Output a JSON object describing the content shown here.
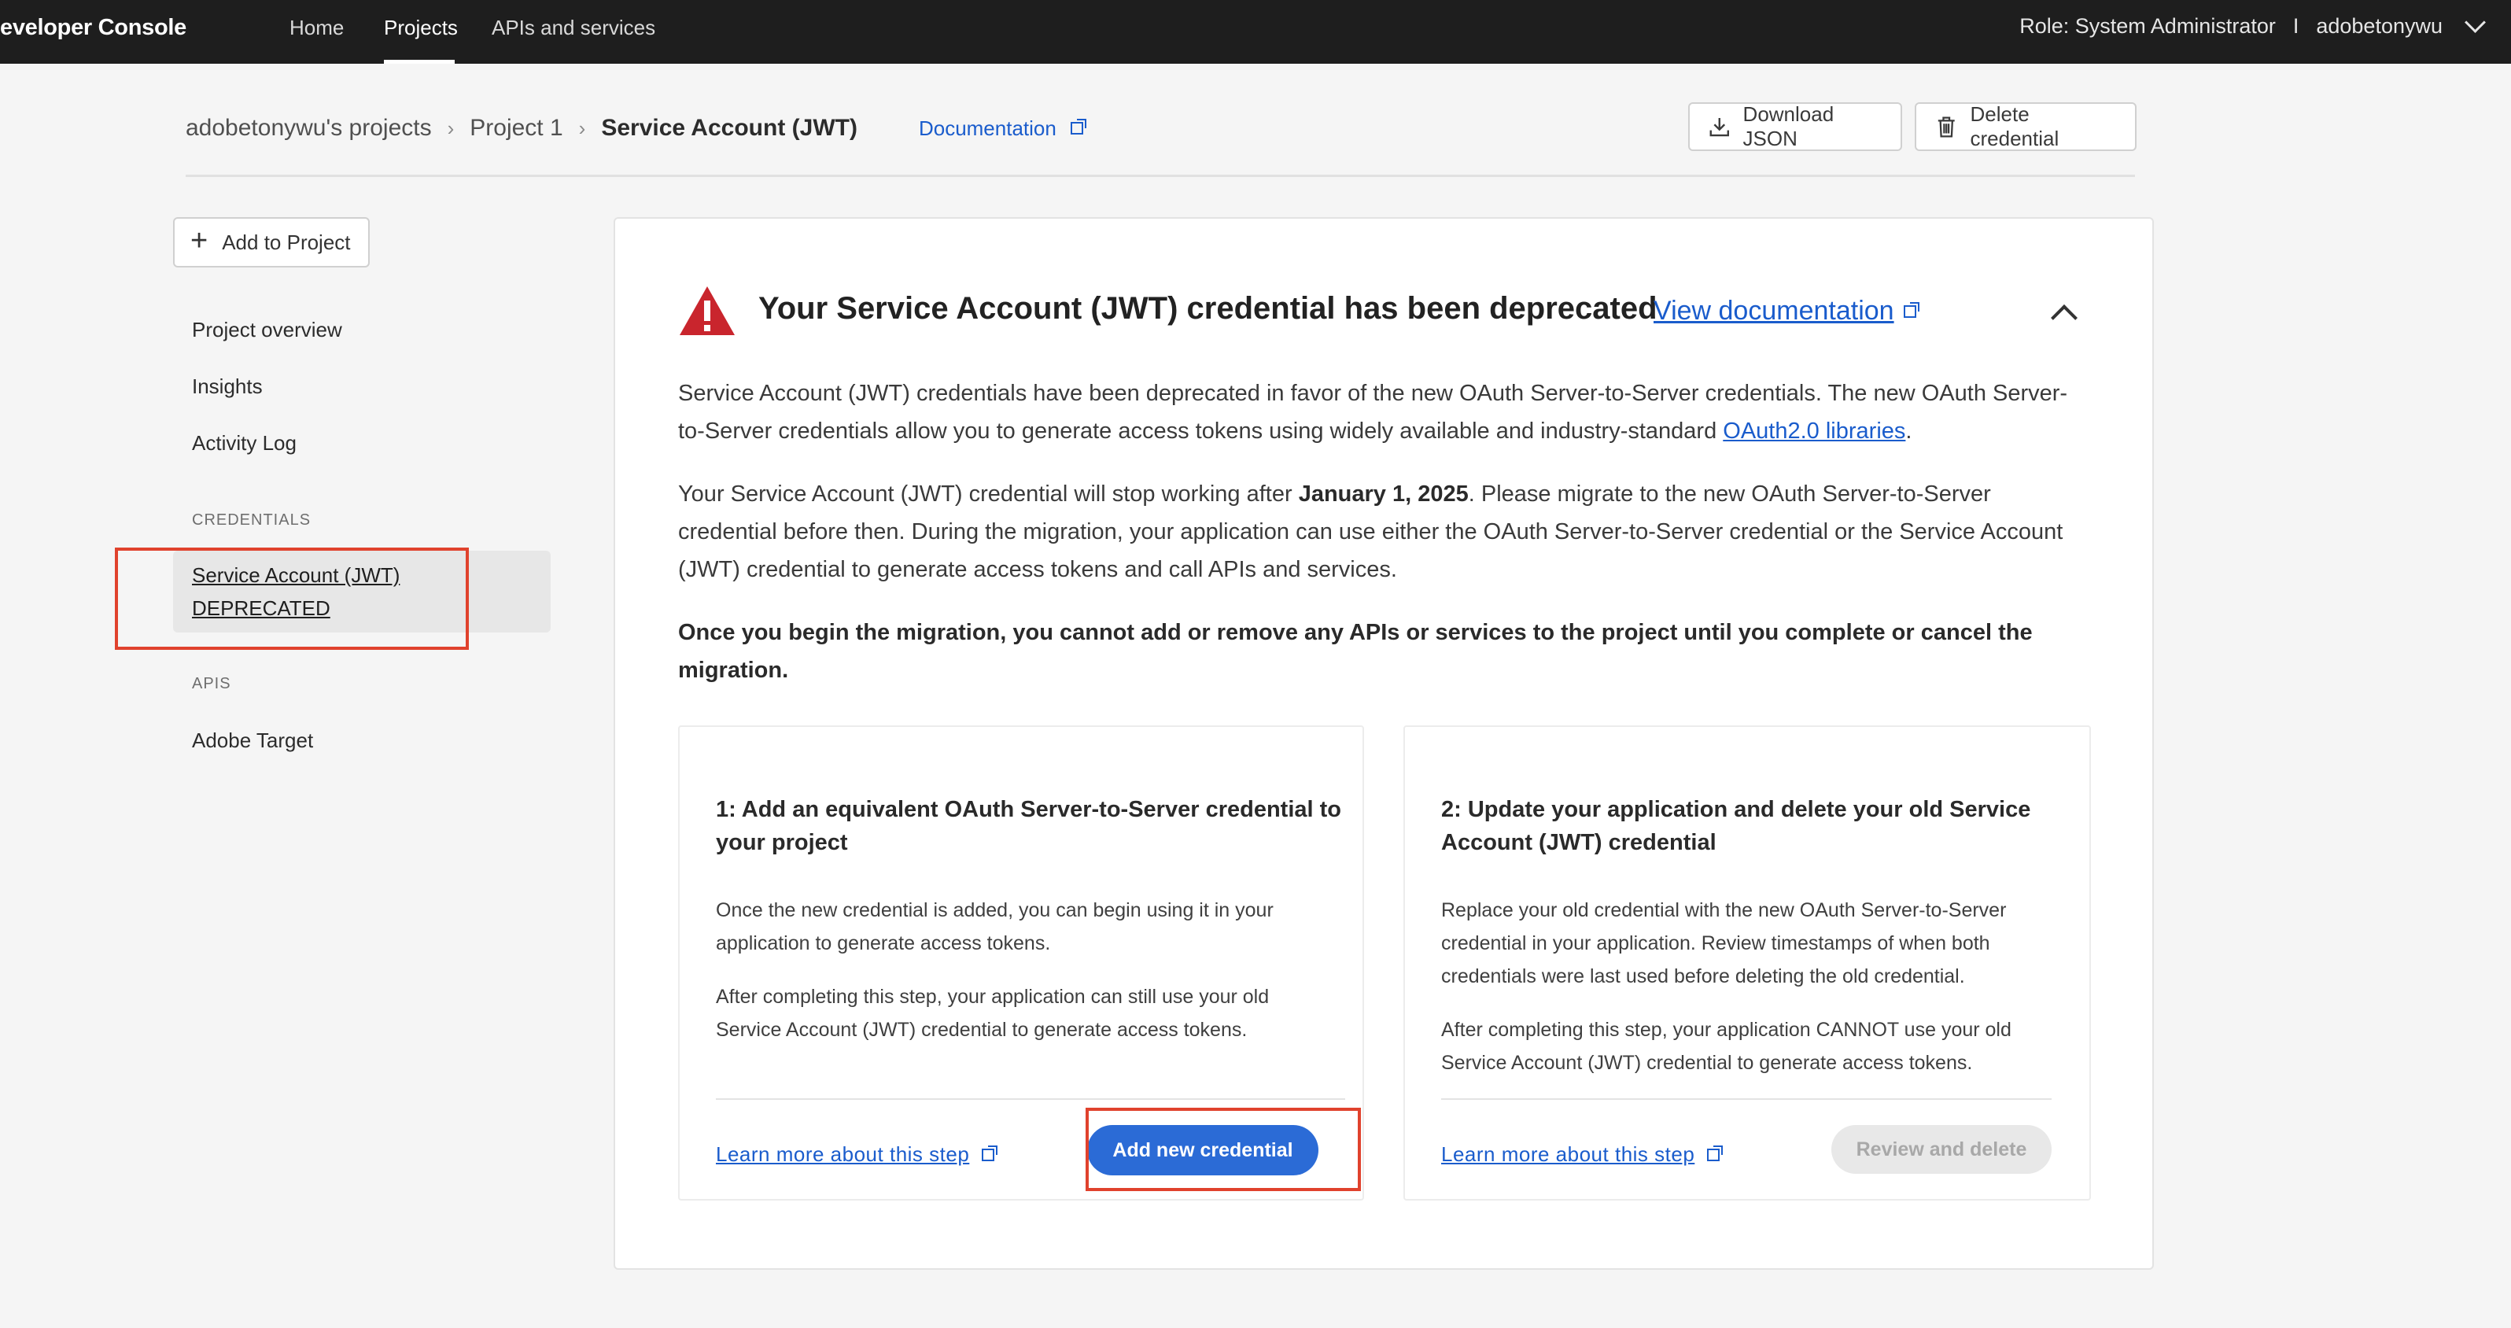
{
  "topbar": {
    "brand": "eveloper Console",
    "tabs": [
      {
        "label": "Home"
      },
      {
        "label": "Projects"
      },
      {
        "label": "APIs and services"
      }
    ],
    "role": "Role: System Administrator",
    "divider": "I",
    "user": "adobetonywu"
  },
  "breadcrumb": {
    "items": [
      "adobetonywu's projects",
      "Project 1",
      "Service Account (JWT)"
    ],
    "doc_link": "Documentation"
  },
  "header_actions": {
    "download": "Download JSON",
    "delete": "Delete credential"
  },
  "sidebar": {
    "add_button": "Add to Project",
    "items": [
      "Project overview",
      "Insights",
      "Activity Log"
    ],
    "credentials_heading": "CREDENTIALS",
    "selected_line1": "Service Account (JWT)",
    "selected_line2": "DEPRECATED",
    "apis_heading": "APIS",
    "api_item": "Adobe Target"
  },
  "banner": {
    "title": "Your Service Account (JWT) credential has been deprecated",
    "view_doc": "View documentation",
    "p1_text": "Service Account (JWT) credentials have been deprecated in favor of the new OAuth Server-to-Server credentials. The new OAuth Server-to-Server credentials allow you to generate access tokens using widely available and industry-standard ",
    "p1_link": "OAuth2.0 libraries",
    "p1_end": ".",
    "p2_start": "Your Service Account (JWT) credential will stop working after ",
    "p2_date": "January 1, 2025",
    "p2_end": ". Please migrate to the new OAuth Server-to-Server credential before then. During the migration, your application can use either the OAuth Server-to-Server credential or the Service Account (JWT) credential to generate access tokens and call APIs and services.",
    "p3": "Once you begin the migration, you cannot add or remove any APIs or services to the project until you complete or cancel the migration."
  },
  "step1": {
    "title": "1: Add an equivalent OAuth Server-to-Server credential to your project",
    "text1": "Once the new credential is added, you can begin using it in your application to generate access tokens.",
    "text2": "After completing this step, your application can still use your old Service Account (JWT) credential to generate access tokens.",
    "learn": "Learn more about this step",
    "button": "Add new credential"
  },
  "step2": {
    "title": "2: Update your application and delete your old Service Account (JWT) credential",
    "text1": "Replace your old credential with the new OAuth Server-to-Server credential in your application. Review timestamps of when both credentials were last used before deleting the old credential.",
    "text2": "After completing this step, your application CANNOT use your old Service Account (JWT) credential to generate access tokens.",
    "learn": "Learn more about this step",
    "button": "Review and delete"
  },
  "colors": {
    "accent": "#2b6bd6",
    "link": "#1a5ccc",
    "warning": "#c9252d",
    "highlight_box": "#e0422d",
    "topbar": "#1e1e1e"
  }
}
